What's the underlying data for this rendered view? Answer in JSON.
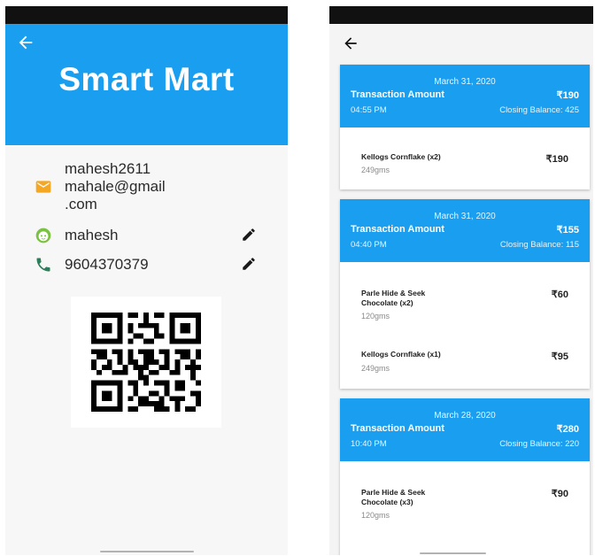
{
  "profile": {
    "brand": "Smart Mart",
    "email_line1": "mahesh2611",
    "email_line2": "mahale@gmail",
    "email_line3": ".com",
    "username": "mahesh",
    "phone": "9604370379"
  },
  "transactions": [
    {
      "date": "March 31, 2020",
      "label": "Transaction Amount",
      "amount": "₹190",
      "time": "04:55 PM",
      "balance": "Closing Balance: 425",
      "items": [
        {
          "name": "Kellogs Cornflake (x2)",
          "weight": "249gms",
          "price": "₹190"
        }
      ]
    },
    {
      "date": "March 31, 2020",
      "label": "Transaction Amount",
      "amount": "₹155",
      "time": "04:40 PM",
      "balance": "Closing Balance: 115",
      "items": [
        {
          "name": "Parle Hide & Seek Chocolate (x2)",
          "weight": "120gms",
          "price": "₹60"
        },
        {
          "name": "Kellogs Cornflake (x1)",
          "weight": "249gms",
          "price": "₹95"
        }
      ]
    },
    {
      "date": "March 28, 2020",
      "label": "Transaction Amount",
      "amount": "₹280",
      "time": "10:40 PM",
      "balance": "Closing Balance: 220",
      "items": [
        {
          "name": "Parle Hide & Seek Chocolate (x3)",
          "weight": "120gms",
          "price": "₹90"
        }
      ]
    }
  ],
  "colors": {
    "primary": "#1a9ff0",
    "email_icon": "#f5a623",
    "face_icon": "#7cc242",
    "phone_icon": "#2e7d5b"
  },
  "icons": [
    "back-arrow-icon",
    "email-icon",
    "face-icon",
    "phone-icon",
    "edit-pencil-icon",
    "qr-code"
  ]
}
